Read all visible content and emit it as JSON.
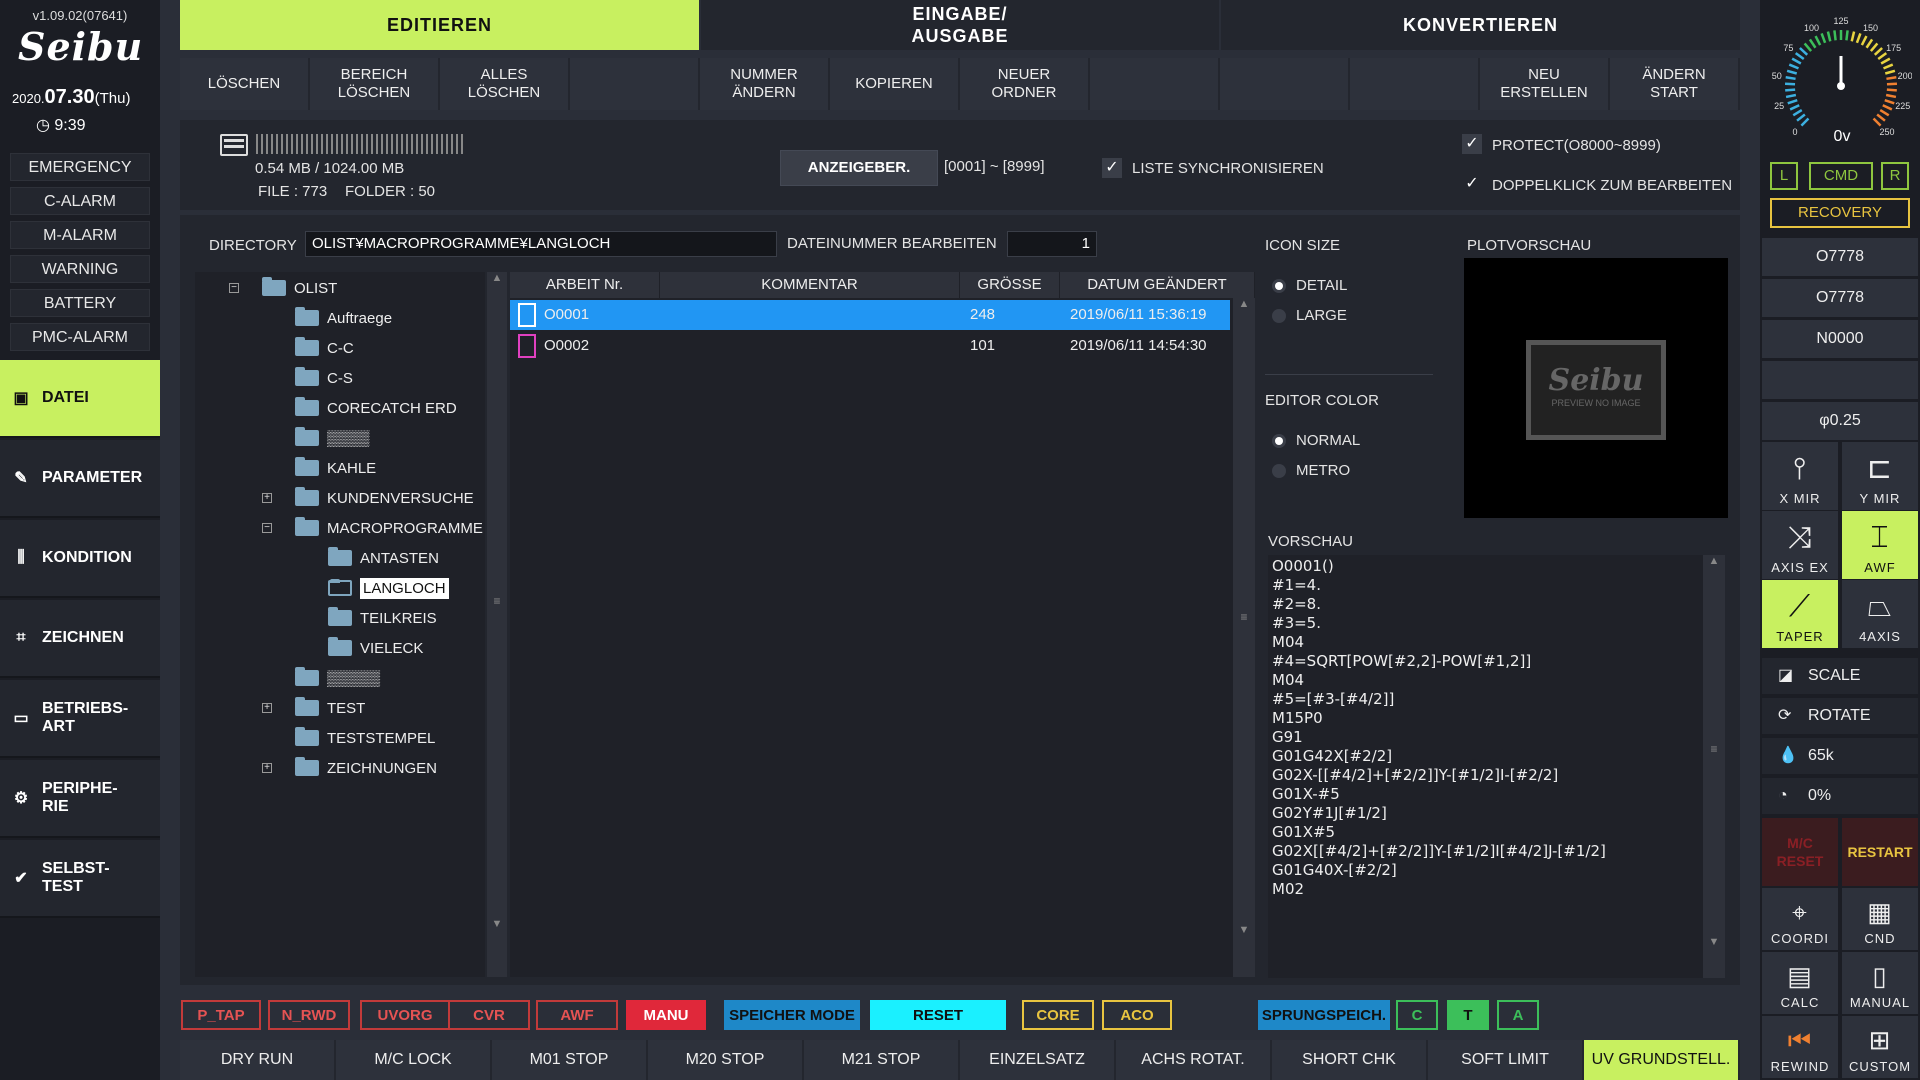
{
  "version": "v1.09.02(07641)",
  "brand": "Seibu",
  "date": {
    "year": "2020.",
    "day": "07.30",
    "weekday": "(Thu)",
    "time": "9:39"
  },
  "alarms": [
    "EMERGENCY",
    "C-ALARM",
    "M-ALARM",
    "WARNING",
    "BATTERY",
    "PMC-ALARM"
  ],
  "nav": [
    {
      "label": "DATEI",
      "icon": "file-icon"
    },
    {
      "label": "PARAMETER",
      "icon": "wrench-icon"
    },
    {
      "label": "KONDITION",
      "icon": "sliders-icon"
    },
    {
      "label": "ZEICHNEN",
      "icon": "draw-icon"
    },
    {
      "label": "BETRIEBS-\nART",
      "icon": "mode-icon"
    },
    {
      "label": "PERIPHE-\nRIE",
      "icon": "gear-icon"
    },
    {
      "label": "SELBST-\nTEST",
      "icon": "check-icon"
    }
  ],
  "tabs": [
    "EDITIEREN",
    "EINGABE/\nAUSGABE",
    "KONVERTIEREN"
  ],
  "softkeys": [
    "LÖSCHEN",
    "BEREICH\nLÖSCHEN",
    "ALLES\nLÖSCHEN",
    "",
    "NUMMER\nÄNDERN",
    "KOPIEREN",
    "NEUER\nORDNER",
    "",
    "",
    "",
    "NEU\nERSTELLEN",
    "ÄNDERN\nSTART"
  ],
  "storage": {
    "usage": "0.54 MB / 1024.00 MB",
    "files": "FILE : 773",
    "folders": "FOLDER : 50"
  },
  "display_range_button": "ANZEIGEBER.",
  "range": "[0001] ~ [8999]",
  "sync_list": "LISTE SYNCHRONISIEREN",
  "protect": "PROTECT(O8000~8999)",
  "dblclick": "DOPPELKLICK ZUM BEARBEITEN",
  "directory_label": "DIRECTORY",
  "directory": "OLIST¥MACROPROGRAMME¥LANGLOCH",
  "filenum_label": "DATEINUMMER BEARBEITEN",
  "filenum": "1",
  "tree": [
    {
      "label": "OLIST",
      "level": 0,
      "exp": "−"
    },
    {
      "label": "Auftraege",
      "level": 1
    },
    {
      "label": "C-C",
      "level": 1
    },
    {
      "label": "C-S",
      "level": 1
    },
    {
      "label": "CORECATCH ERD",
      "level": 1
    },
    {
      "label": "▒▒▒▒",
      "level": 1
    },
    {
      "label": "KAHLE",
      "level": 1
    },
    {
      "label": "KUNDENVERSUCHE",
      "level": 1,
      "exp": "+"
    },
    {
      "label": "MACROPROGRAMME",
      "level": 1,
      "exp": "−"
    },
    {
      "label": "ANTASTEN",
      "level": 2
    },
    {
      "label": "LANGLOCH",
      "level": 2,
      "selected": true
    },
    {
      "label": "TEILKREIS",
      "level": 2
    },
    {
      "label": "VIELECK",
      "level": 2
    },
    {
      "label": "▒▒▒▒▒",
      "level": 1
    },
    {
      "label": "TEST",
      "level": 1,
      "exp": "+"
    },
    {
      "label": "TESTSTEMPEL",
      "level": 1
    },
    {
      "label": "ZEICHNUNGEN",
      "level": 1,
      "exp": "+"
    }
  ],
  "file_headers": [
    "ARBEIT Nr.",
    "KOMMENTAR",
    "GRÖSSE",
    "DATUM GEÄNDERT"
  ],
  "files": [
    {
      "nr": "O0001",
      "comment": "",
      "size": "248",
      "date": "2019/06/11 15:36:19",
      "selected": true,
      "color": "#ffffff"
    },
    {
      "nr": "O0002",
      "comment": "",
      "size": "101",
      "date": "2019/06/11 14:54:30",
      "selected": false,
      "color": "#e040c0"
    }
  ],
  "icon_size": {
    "title": "ICON SIZE",
    "options": [
      "DETAIL",
      "LARGE"
    ],
    "selected": 0
  },
  "editor_color": {
    "title": "EDITOR COLOR",
    "options": [
      "NORMAL",
      "METRO"
    ],
    "selected": 0
  },
  "plot_title": "PLOTVORSCHAU",
  "plot_logo": "Seibu",
  "plot_noimage": "PREVIEW NO IMAGE",
  "preview_title": "VORSCHAU",
  "preview_code": [
    "O0001()",
    "#1=4.",
    "#2=8.",
    "#3=5.",
    "M04",
    "#4=SQRT[POW[#2,2]-POW[#1,2]]",
    "M04",
    "#5=[#3-[#4/2]]",
    "M15P0",
    "G91",
    "G01G42X[#2/2]",
    "G02X-[[#4/2]+[#2/2]]Y-[#1/2]I-[#2/2]",
    "G01X-#5",
    "G02Y#1J[#1/2]",
    "G01X#5",
    "G02X[[#4/2]+[#2/2]]Y-[#1/2]I[#4/2]J-[#1/2]",
    "G01G40X-[#2/2]",
    "M02"
  ],
  "indicators": [
    {
      "label": "P_TAP",
      "style": "red"
    },
    {
      "label": "N_RWD",
      "style": "red"
    },
    {
      "label": "UVORG",
      "style": "red"
    },
    {
      "label": "CVR",
      "style": "red"
    },
    {
      "label": "AWF",
      "style": "red"
    },
    {
      "label": "MANU",
      "style": "redfill"
    },
    {
      "label": "SPEICHER MODE",
      "style": "blue"
    },
    {
      "label": "RESET",
      "style": "cyan"
    },
    {
      "label": "CORE",
      "style": "yellow"
    },
    {
      "label": "ACO",
      "style": "yellow"
    },
    {
      "label": "SPRUNGSPEICH.",
      "style": "blue"
    },
    {
      "label": "C",
      "style": "green"
    },
    {
      "label": "T",
      "style": "greenfill"
    },
    {
      "label": "A",
      "style": "green"
    }
  ],
  "function_keys": [
    "DRY RUN",
    "M/C LOCK",
    "M01 STOP",
    "M20 STOP",
    "M21 STOP",
    "EINZELSATZ",
    "ACHS ROTAT.",
    "SHORT CHK",
    "SOFT LIMIT",
    "UV GRUNDSTELL."
  ],
  "gauge": {
    "value": "0v",
    "ticks": [
      "0",
      "25",
      "50",
      "75",
      "100",
      "125",
      "150",
      "175",
      "200",
      "225",
      "250"
    ],
    "level": 0.5
  },
  "lr": [
    "L",
    "CMD",
    "R"
  ],
  "recovery": "RECOVERY",
  "status": [
    "O7778",
    "O7778",
    "N0000",
    "",
    "φ0.25"
  ],
  "icon_buttons": [
    {
      "label": "X MIR",
      "icon": "x-mirror-icon",
      "on": false
    },
    {
      "label": "Y MIR",
      "icon": "y-mirror-icon",
      "on": false
    },
    {
      "label": "AXIS EX",
      "icon": "axis-exchange-icon",
      "on": false
    },
    {
      "label": "AWF",
      "icon": "awf-icon",
      "on": true
    },
    {
      "label": "TAPER",
      "icon": "taper-icon",
      "on": true
    },
    {
      "label": "4AXIS",
      "icon": "4axis-icon",
      "on": false
    }
  ],
  "right_rows": [
    {
      "label": "SCALE",
      "icon": "scale-icon"
    },
    {
      "label": "ROTATE",
      "icon": "rotate-icon"
    },
    {
      "label": "65k",
      "icon": "water-drop-icon"
    },
    {
      "label": "0%",
      "icon": "speed-dial-icon"
    }
  ],
  "mc_reset": "M/C\nRESET",
  "restart": "RESTART",
  "bottom_icons": [
    {
      "label": "COORDI",
      "icon": "coordinate-icon"
    },
    {
      "label": "CND",
      "icon": "cnd-icon"
    },
    {
      "label": "CALC",
      "icon": "calculator-icon"
    },
    {
      "label": "MANUAL",
      "icon": "manual-icon"
    },
    {
      "label": "REWIND",
      "icon": "rewind-icon"
    },
    {
      "label": "CUSTOM",
      "icon": "custom-icon"
    }
  ],
  "colors": {
    "accent": "#c8f060",
    "selected": "#2196f3",
    "panel": "#23262e"
  }
}
